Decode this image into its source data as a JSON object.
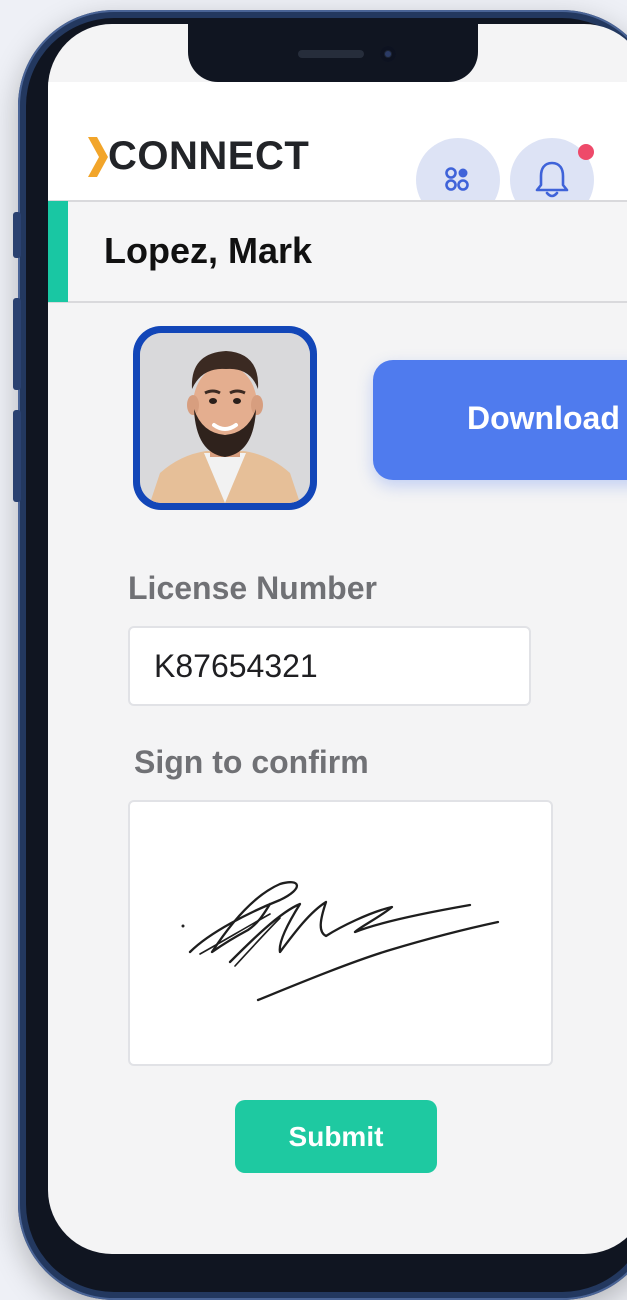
{
  "header": {
    "logo_text": "CONNECT",
    "logo_accent_color": "#f2a52a",
    "apps_icon": "apps-grid-icon",
    "notifications_icon": "bell-icon",
    "notification_dot_color": "#ee4a6a"
  },
  "profile": {
    "name": "Lopez, Mark",
    "name_accent_color": "#19c7a3",
    "photo_icon": "user-photo"
  },
  "actions": {
    "download_label": "Download",
    "download_color": "#4f7bee"
  },
  "form": {
    "license_label": "License Number",
    "license_value": "K87654321",
    "sign_label": "Sign to confirm",
    "submit_label": "Submit",
    "submit_color": "#1ec9a1"
  }
}
